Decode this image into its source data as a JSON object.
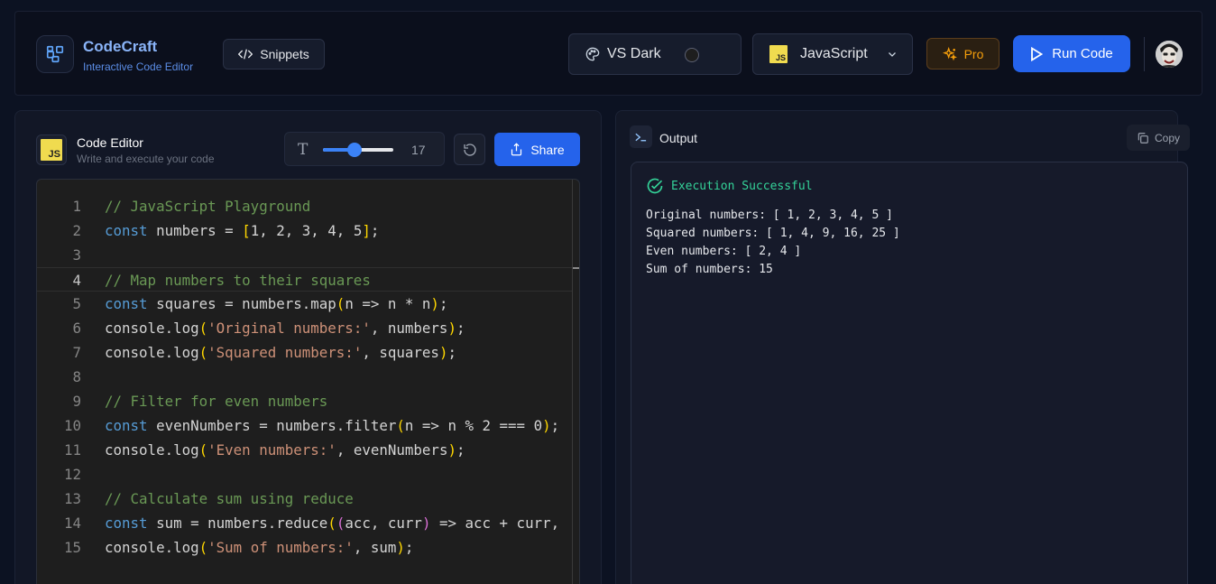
{
  "header": {
    "brand_name": "CodeCraft",
    "brand_subtitle": "Interactive Code Editor",
    "snippets_label": "Snippets",
    "theme_label": "VS Dark",
    "language_label": "JavaScript",
    "language_badge": "JS",
    "pro_label": "Pro",
    "run_label": "Run Code",
    "icons": [
      "logo-icon",
      "code-icon",
      "palette-icon",
      "chevron-down-icon",
      "sparkles-icon",
      "play-icon",
      "avatar"
    ]
  },
  "editor": {
    "badge": "JS",
    "title": "Code Editor",
    "subtitle": "Write and execute your code",
    "font_size": "17",
    "font_size_fraction": 0.45,
    "share_label": "Share",
    "active_line": 4,
    "lines": [
      {
        "n": "1",
        "tokens": [
          [
            "c",
            "// JavaScript Playground"
          ]
        ]
      },
      {
        "n": "2",
        "tokens": [
          [
            "k",
            "const"
          ],
          [
            "p",
            " numbers = "
          ],
          [
            "b1",
            "["
          ],
          [
            "p",
            "1, 2, 3, 4, 5"
          ],
          [
            "b1",
            "]"
          ],
          [
            "p",
            ";"
          ]
        ]
      },
      {
        "n": "3",
        "tokens": []
      },
      {
        "n": "4",
        "tokens": [
          [
            "c",
            "// Map numbers to their squares"
          ]
        ]
      },
      {
        "n": "5",
        "tokens": [
          [
            "k",
            "const"
          ],
          [
            "p",
            " squares = numbers.map"
          ],
          [
            "b1",
            "("
          ],
          [
            "p",
            "n => n * n"
          ],
          [
            "b1",
            ")"
          ],
          [
            "p",
            ";"
          ]
        ]
      },
      {
        "n": "6",
        "tokens": [
          [
            "p",
            "console.log"
          ],
          [
            "b1",
            "("
          ],
          [
            "s",
            "'Original numbers:'"
          ],
          [
            "p",
            ", numbers"
          ],
          [
            "b1",
            ")"
          ],
          [
            "p",
            ";"
          ]
        ]
      },
      {
        "n": "7",
        "tokens": [
          [
            "p",
            "console.log"
          ],
          [
            "b1",
            "("
          ],
          [
            "s",
            "'Squared numbers:'"
          ],
          [
            "p",
            ", squares"
          ],
          [
            "b1",
            ")"
          ],
          [
            "p",
            ";"
          ]
        ]
      },
      {
        "n": "8",
        "tokens": []
      },
      {
        "n": "9",
        "tokens": [
          [
            "c",
            "// Filter for even numbers"
          ]
        ]
      },
      {
        "n": "10",
        "tokens": [
          [
            "k",
            "const"
          ],
          [
            "p",
            " evenNumbers = numbers.filter"
          ],
          [
            "b1",
            "("
          ],
          [
            "p",
            "n => n % "
          ],
          [
            "p",
            "2"
          ],
          [
            "p",
            " === "
          ],
          [
            "p",
            "0"
          ],
          [
            "b1",
            ")"
          ],
          [
            "p",
            ";"
          ]
        ]
      },
      {
        "n": "11",
        "tokens": [
          [
            "p",
            "console.log"
          ],
          [
            "b1",
            "("
          ],
          [
            "s",
            "'Even numbers:'"
          ],
          [
            "p",
            ", evenNumbers"
          ],
          [
            "b1",
            ")"
          ],
          [
            "p",
            ";"
          ]
        ]
      },
      {
        "n": "12",
        "tokens": []
      },
      {
        "n": "13",
        "tokens": [
          [
            "c",
            "// Calculate sum using reduce"
          ]
        ]
      },
      {
        "n": "14",
        "tokens": [
          [
            "k",
            "const"
          ],
          [
            "p",
            " sum = numbers.reduce"
          ],
          [
            "b1",
            "("
          ],
          [
            "b2",
            "("
          ],
          [
            "p",
            "acc, curr"
          ],
          [
            "b2",
            ")"
          ],
          [
            "p",
            " => acc + curr,"
          ]
        ]
      },
      {
        "n": "15",
        "tokens": [
          [
            "p",
            "console.log"
          ],
          [
            "b1",
            "("
          ],
          [
            "s",
            "'Sum of numbers:'"
          ],
          [
            "p",
            ", sum"
          ],
          [
            "b1",
            ")"
          ],
          [
            "p",
            ";"
          ]
        ]
      }
    ]
  },
  "output": {
    "title": "Output",
    "copy_label": "Copy",
    "status": "Execution Successful",
    "lines": [
      "Original numbers: [ 1, 2, 3, 4, 5 ]",
      "Squared numbers: [ 1, 4, 9, 16, 25 ]",
      "Even numbers: [ 2, 4 ]",
      "Sum of numbers: 15"
    ]
  },
  "colors": {
    "accent": "#2563eb",
    "success": "#34d399",
    "pro": "#f59e0b",
    "js": "#f0db4f"
  }
}
